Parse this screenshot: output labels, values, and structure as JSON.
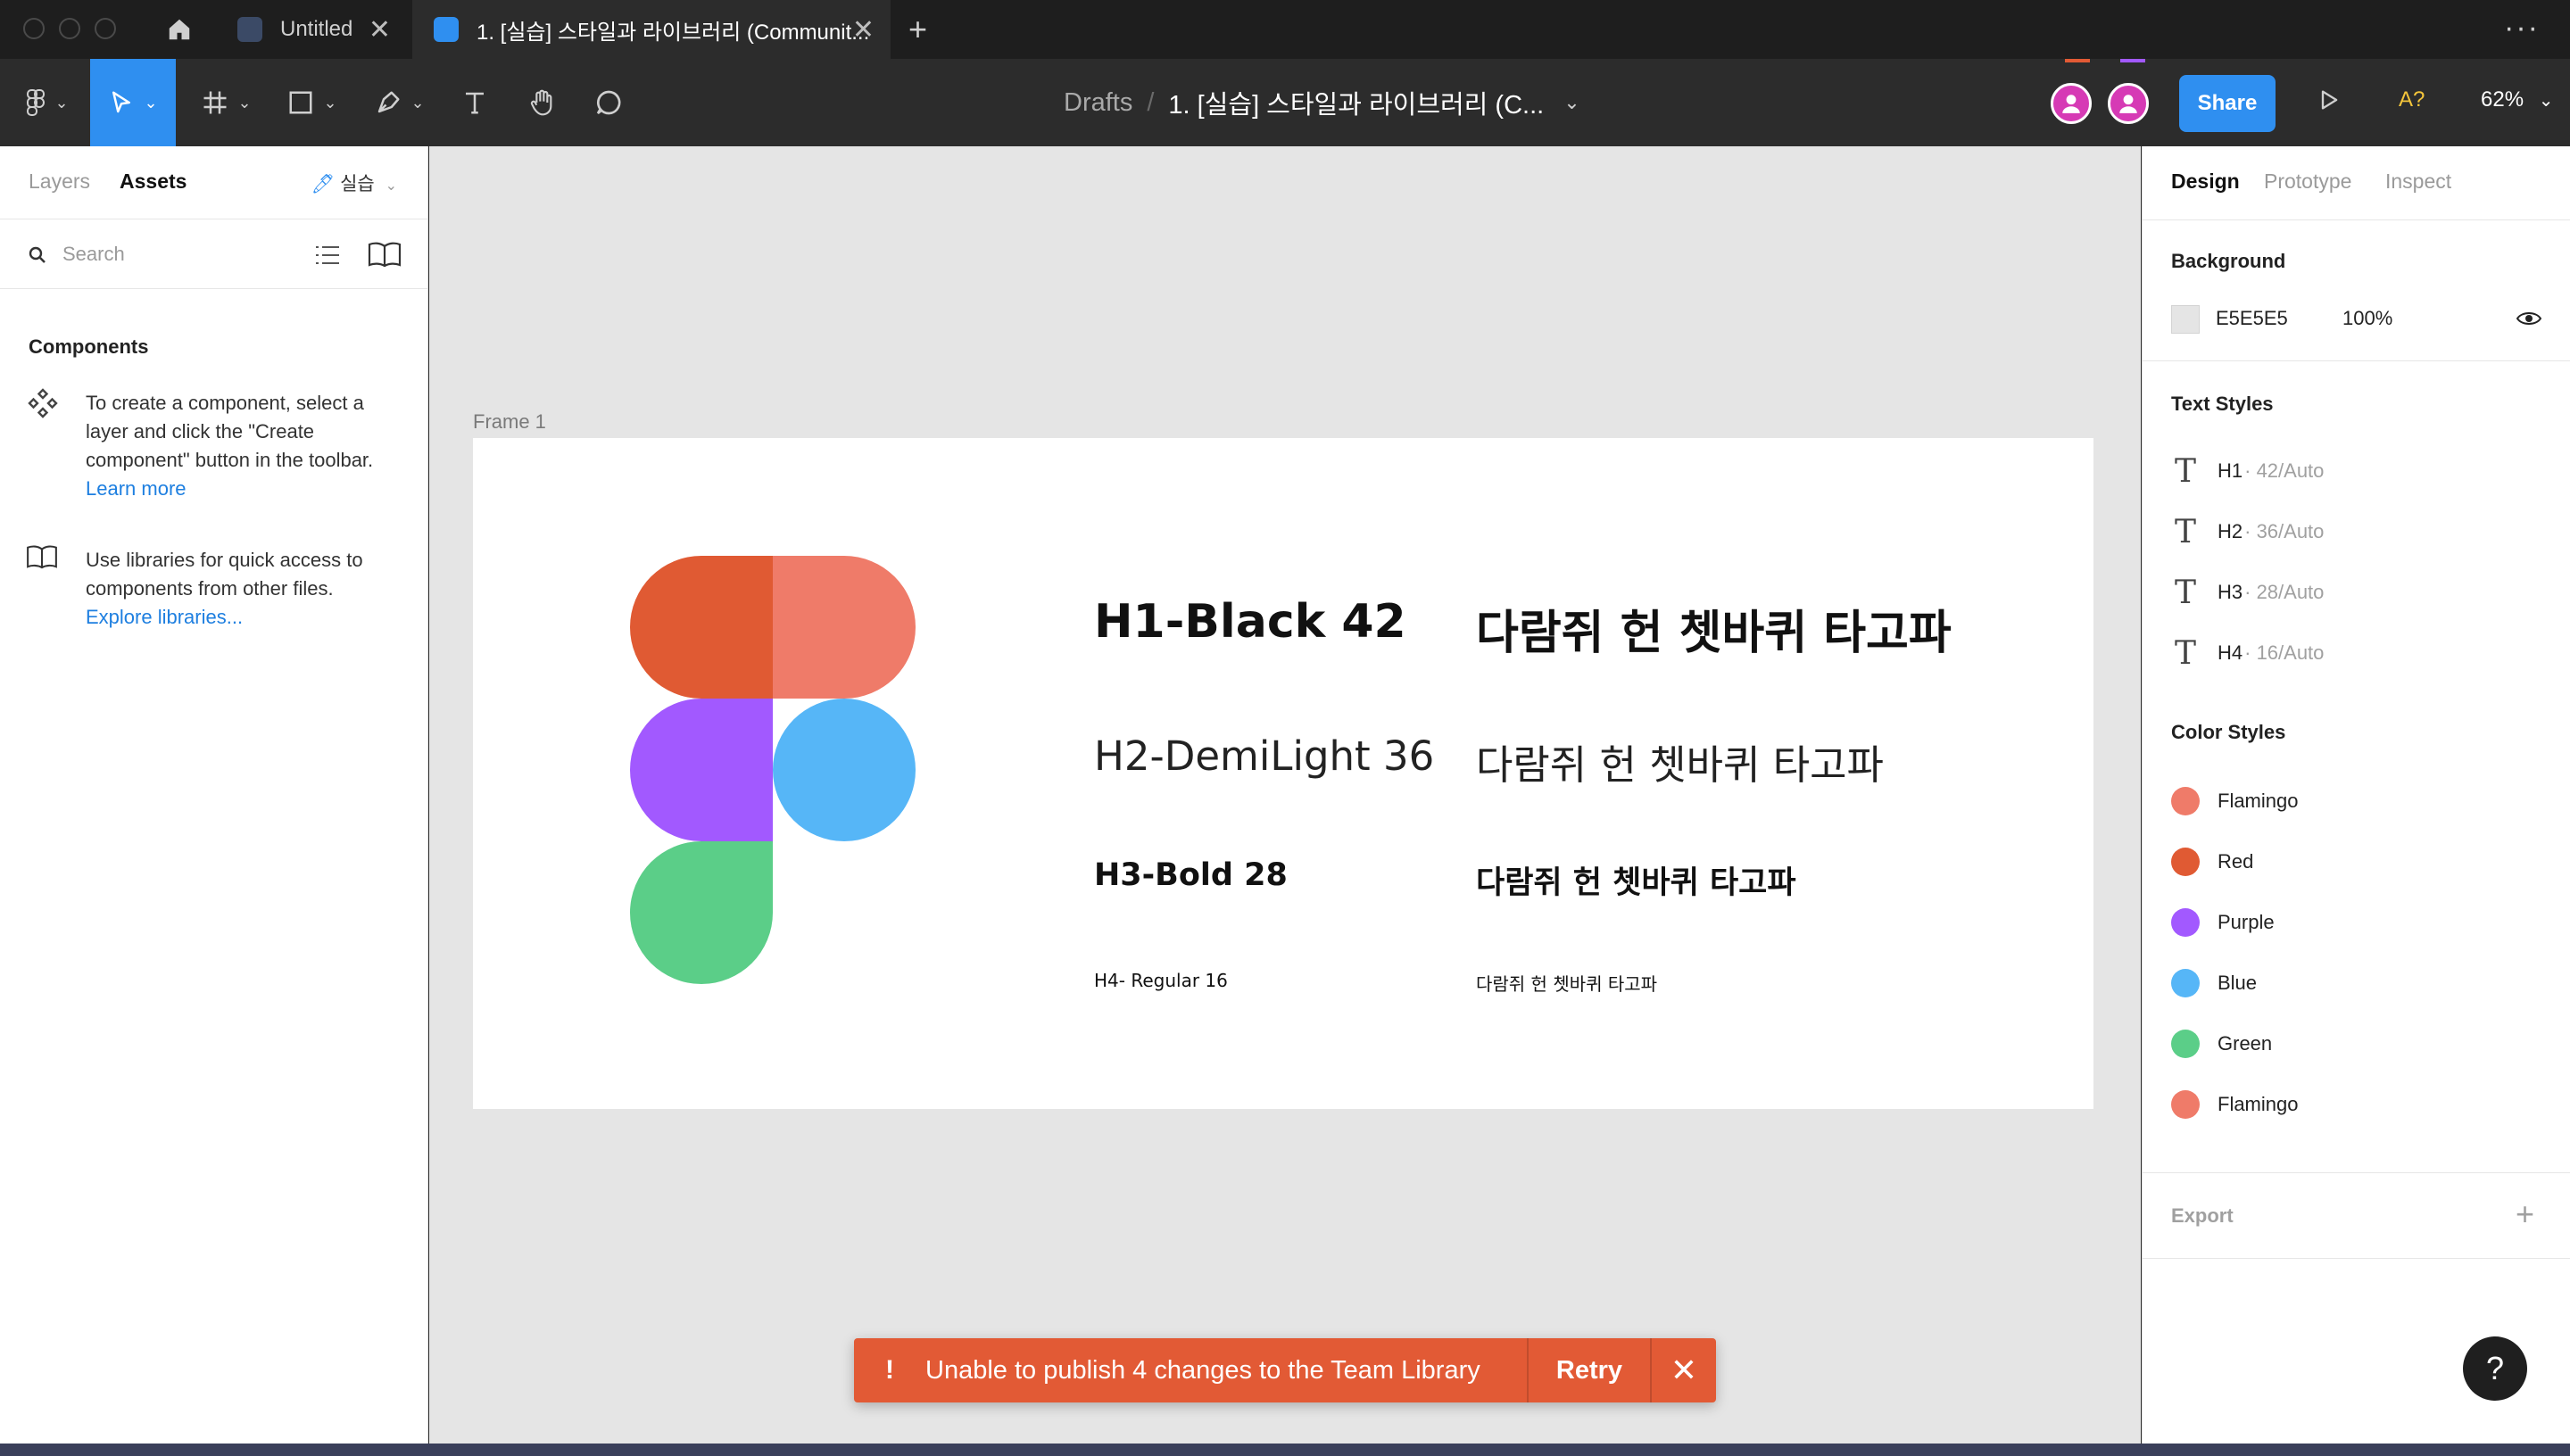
{
  "titlebar": {
    "tabs": [
      {
        "label": "Untitled",
        "active": false
      },
      {
        "label": "1. [실습] 스타일과 라이브러리 (Communit...",
        "active": true
      }
    ]
  },
  "toolbar": {
    "breadcrumb_drafts": "Drafts",
    "breadcrumb_sep": "/",
    "breadcrumb_file": "1. [실습] 스타일과 라이브러리 (C...",
    "share_label": "Share",
    "font_warning": "A?",
    "zoom": "62%"
  },
  "left_panel": {
    "tabs": [
      "Layers",
      "Assets"
    ],
    "page_label": "실습",
    "search_placeholder": "Search",
    "components_title": "Components",
    "components_help": "To create a component, select a layer and click the \"Create component\" button in the toolbar.",
    "learn_more": "Learn more",
    "libraries_help": "Use libraries for quick access to components from other files.",
    "explore_libraries": "Explore libraries..."
  },
  "canvas": {
    "frame_label": "Frame 1",
    "text_samples": [
      {
        "label": "H1-Black 42",
        "sample": "다람쥐 헌 쳇바퀴 타고파"
      },
      {
        "label": "H2-DemiLight 36",
        "sample": "다람쥐 헌 쳇바퀴 타고파"
      },
      {
        "label": "H3-Bold  28",
        "sample": "다람쥐 헌 쳇바퀴 타고파"
      },
      {
        "label": "H4- Regular  16",
        "sample": "다람쥐 헌 쳇바퀴 타고파"
      }
    ],
    "logo_colors": {
      "red": "#E05A33",
      "flamingo": "#EF7B69",
      "purple": "#A259FF",
      "blue": "#56B6F7",
      "green": "#5BCE88"
    }
  },
  "right_panel": {
    "tabs": [
      "Design",
      "Prototype",
      "Inspect"
    ],
    "background_title": "Background",
    "background_hex": "E5E5E5",
    "background_opacity": "100%",
    "text_styles_title": "Text Styles",
    "text_styles": [
      {
        "name": "H1",
        "meta": "· 42/Auto"
      },
      {
        "name": "H2",
        "meta": "· 36/Auto"
      },
      {
        "name": "H3",
        "meta": "· 28/Auto"
      },
      {
        "name": "H4",
        "meta": "· 16/Auto"
      }
    ],
    "color_styles_title": "Color Styles",
    "color_styles": [
      {
        "name": "Flamingo",
        "color": "#EF7B69"
      },
      {
        "name": "Red",
        "color": "#E05A33"
      },
      {
        "name": "Purple",
        "color": "#A259FF"
      },
      {
        "name": "Blue",
        "color": "#56B6F7"
      },
      {
        "name": "Green",
        "color": "#5BCE88"
      },
      {
        "name": "Flamingo",
        "color": "#EF7B69"
      }
    ],
    "export_label": "Export"
  },
  "toast": {
    "message": "Unable to publish 4 changes to the Team Library",
    "retry": "Retry"
  },
  "help": "?"
}
